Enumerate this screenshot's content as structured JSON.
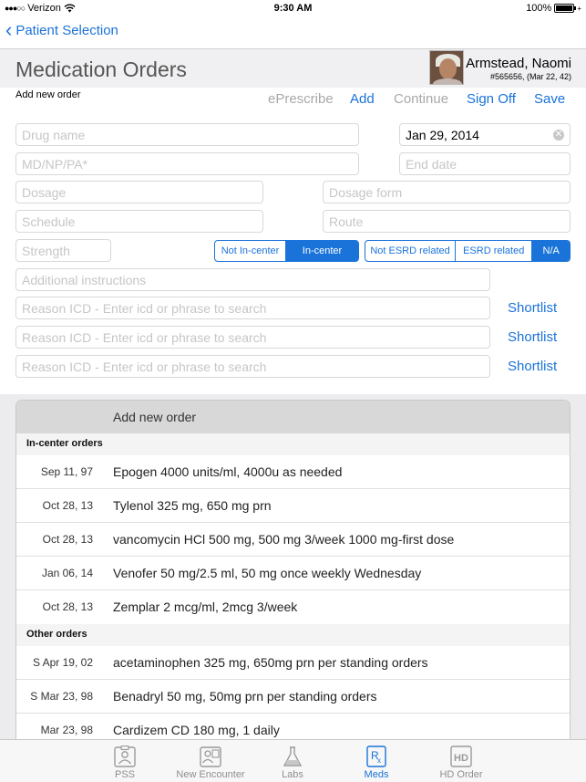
{
  "status": {
    "carrier": "Verizon",
    "time": "9:30 AM",
    "battery": "100%"
  },
  "nav": {
    "back_label": "Patient Selection"
  },
  "header": {
    "title": "Medication Orders",
    "patient_name": "Armstead, Naomi",
    "patient_id": "#565656, (Mar 22, 42)"
  },
  "toolbar": {
    "add_new_label": "Add new order",
    "eprescribe": "ePrescribe",
    "add": "Add",
    "continue": "Continue",
    "sign_off": "Sign Off",
    "save": "Save"
  },
  "form": {
    "drug_name_placeholder": "Drug name",
    "start_date_value": "Jan 29, 2014",
    "provider_placeholder": "MD/NP/PA*",
    "end_date_placeholder": "End date",
    "dosage_placeholder": "Dosage",
    "dosage_form_placeholder": "Dosage form",
    "schedule_placeholder": "Schedule",
    "route_placeholder": "Route",
    "strength_placeholder": "Strength",
    "center_segment": [
      "Not In-center",
      "In-center"
    ],
    "center_selected": "In-center",
    "esrd_segment": [
      "Not ESRD related",
      "ESRD related",
      "N/A"
    ],
    "esrd_selected": "N/A",
    "instructions_placeholder": "Additional instructions",
    "reason_placeholder": "Reason ICD - Enter icd or phrase to search",
    "shortlist_label": "Shortlist"
  },
  "orders": {
    "header": "Add new order",
    "sections": [
      {
        "title": "In-center orders",
        "rows": [
          {
            "date": "Sep 11, 97",
            "desc": "Epogen 4000 units/ml, 4000u as needed"
          },
          {
            "date": "Oct 28, 13",
            "desc": "Tylenol 325 mg, 650 mg prn"
          },
          {
            "date": "Oct 28, 13",
            "desc": "vancomycin HCl 500 mg, 500 mg 3/week 1000 mg-first dose"
          },
          {
            "date": "Jan 06, 14",
            "desc": "Venofer 50 mg/2.5 ml, 50 mg once weekly Wednesday"
          },
          {
            "date": "Oct 28, 13",
            "desc": "Zemplar 2 mcg/ml, 2mcg 3/week"
          }
        ]
      },
      {
        "title": "Other orders",
        "rows": [
          {
            "date": "S Apr 19, 02",
            "desc": "acetaminophen 325 mg, 650mg prn per standing orders"
          },
          {
            "date": "S Mar 23, 98",
            "desc": "Benadryl 50 mg, 50mg prn per standing orders"
          },
          {
            "date": "Mar 23, 98",
            "desc": "Cardizem CD 180 mg, 1 daily"
          }
        ]
      }
    ]
  },
  "tabs": [
    {
      "label": "PSS",
      "icon": "clipboard-person-icon"
    },
    {
      "label": "New Encounter",
      "icon": "clipboard-chart-icon"
    },
    {
      "label": "Labs",
      "icon": "flask-icon"
    },
    {
      "label": "Meds",
      "icon": "rx-icon"
    },
    {
      "label": "HD Order",
      "icon": "hd-document-icon"
    }
  ],
  "active_tab": "Meds",
  "colors": {
    "accent": "#1a73d9",
    "disabled": "#a8a8a8",
    "header_bg": "#f0f0f2"
  }
}
